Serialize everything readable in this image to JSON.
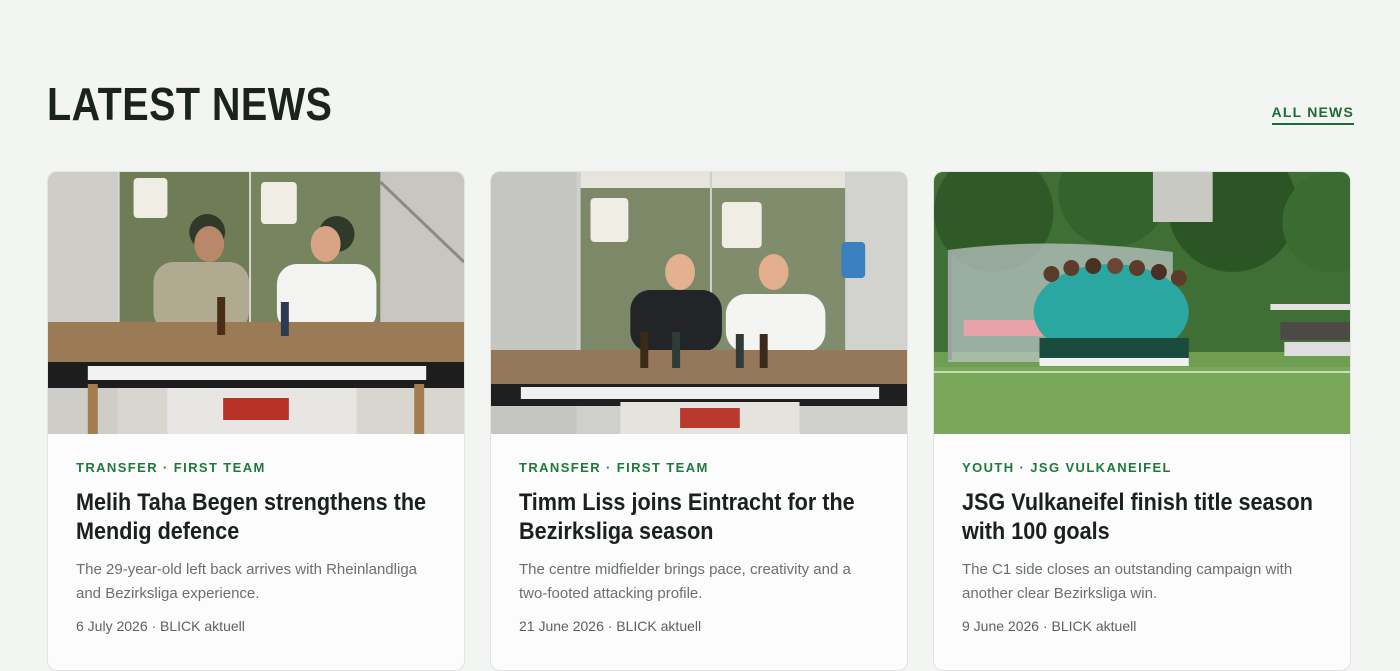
{
  "header": {
    "title": "LATEST NEWS",
    "all_news_label": "ALL NEWS"
  },
  "articles": [
    {
      "category": "TRANSFER · FIRST TEAM",
      "title": "Melih Taha Begen strengthens the Mendig defence",
      "excerpt": "The 29-year-old left back arrives with Rheinlandliga and Bezirksliga experience.",
      "meta": "6 July 2026 · BLICK aktuell",
      "image": "two men signing contract at table with club scarf and beer bottles"
    },
    {
      "category": "TRANSFER · FIRST TEAM",
      "title": "Timm Liss joins Eintracht for the Bezirksliga season",
      "excerpt": "The centre midfielder brings pace, creativity and a two-footed attacking profile.",
      "meta": "21 June 2026 · BLICK aktuell",
      "image": "two men signing contract at table with club scarf"
    },
    {
      "category": "YOUTH · JSG VULKANEIFEL",
      "title": "JSG Vulkaneifel finish title season with 100 goals",
      "excerpt": "The C1 side closes an outstanding campaign with another clear Bezirksliga win.",
      "meta": "9 June 2026 · BLICK aktuell",
      "image": "youth team huddle on a football pitch"
    }
  ],
  "colors": {
    "accent": "#1e7a3c",
    "background": "#f3f5f3",
    "card": "#fbfcfb"
  }
}
